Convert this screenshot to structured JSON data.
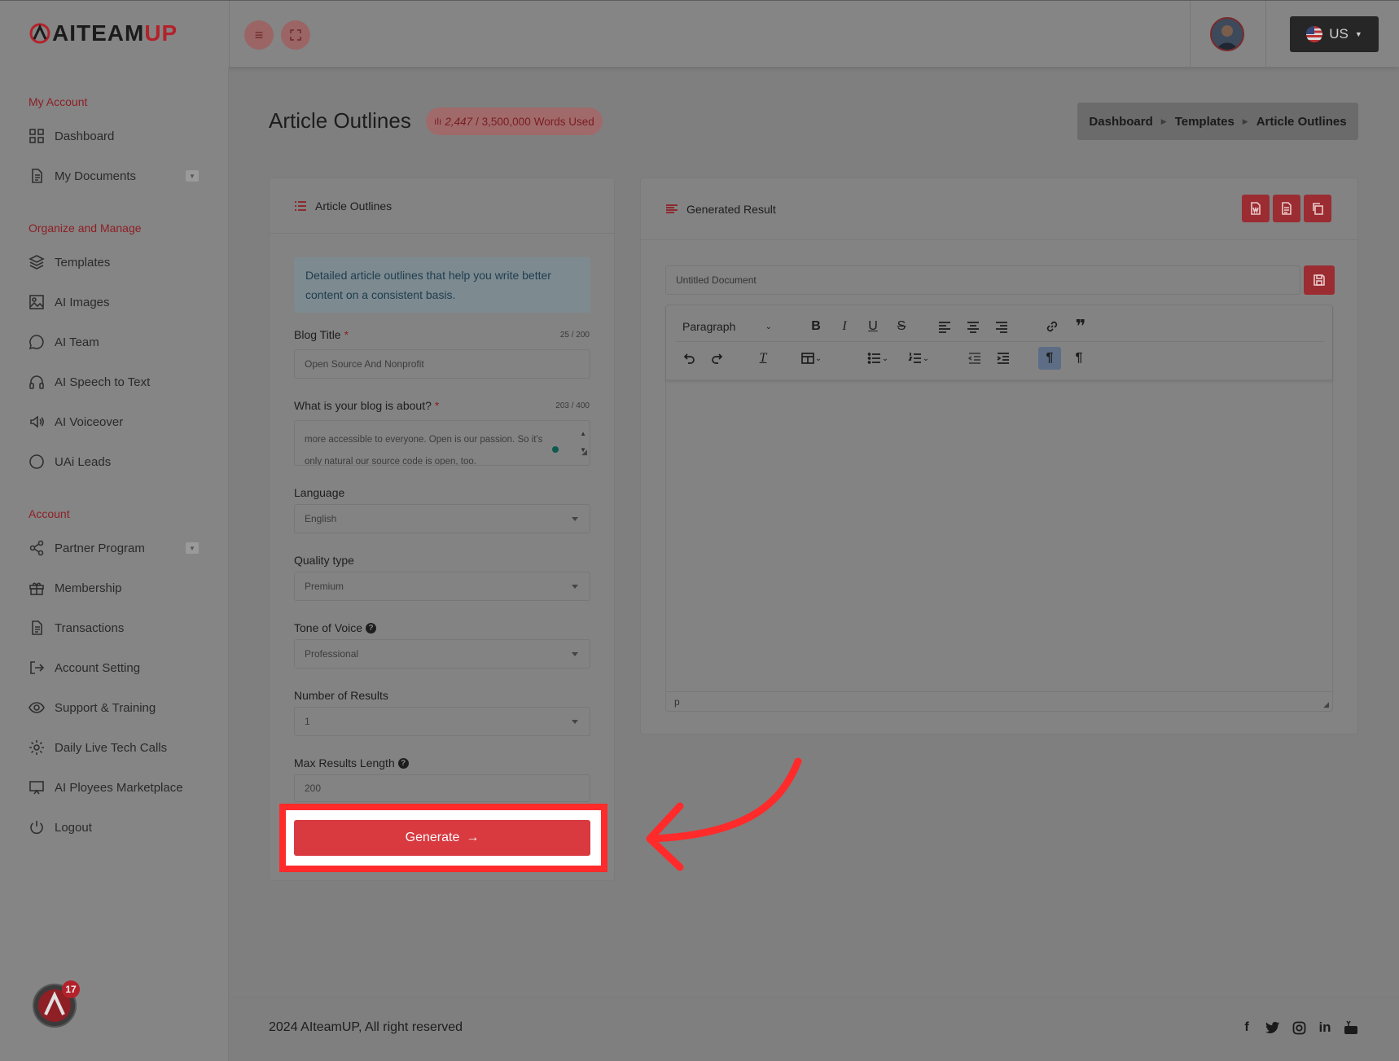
{
  "brand": {
    "name_a": "AITEAM",
    "name_b": "UP"
  },
  "header": {
    "lang": "US"
  },
  "sidebar": {
    "sections": [
      {
        "title": "My Account"
      },
      {
        "title": "Organize and Manage"
      },
      {
        "title": "Account"
      }
    ],
    "items": [
      {
        "label": "Dashboard"
      },
      {
        "label": "My Documents"
      },
      {
        "label": "Templates"
      },
      {
        "label": "AI Images"
      },
      {
        "label": "AI Team"
      },
      {
        "label": "AI Speech to Text"
      },
      {
        "label": "AI Voiceover"
      },
      {
        "label": "UAi Leads"
      },
      {
        "label": "Partner Program"
      },
      {
        "label": "Membership"
      },
      {
        "label": "Transactions"
      },
      {
        "label": "Account Setting"
      },
      {
        "label": "Support & Training"
      },
      {
        "label": "Daily Live Tech Calls"
      },
      {
        "label": "AI Ployees Marketplace"
      },
      {
        "label": "Logout"
      }
    ],
    "notification_count": "17"
  },
  "page": {
    "title": "Article Outlines",
    "words_used": "2,447",
    "words_total": "/ 3,500,000",
    "words_suffix": "Words Used"
  },
  "breadcrumb": {
    "items": [
      "Dashboard",
      "Templates",
      "Article Outlines"
    ]
  },
  "form": {
    "card_title": "Article Outlines",
    "info": "Detailed article outlines that help you write better content on a consistent basis.",
    "blog_title_label": "Blog Title",
    "blog_title_count": "25 / 200",
    "blog_title_value": "Open Source And Nonprofit",
    "about_label": "What is your blog is about?",
    "about_count": "203 / 400",
    "about_value_1": "more accessible to everyone. Open is our passion. So it's",
    "about_value_2": "only natural our source code is open, too.",
    "required_mark": "*",
    "language_label": "Language",
    "language_value": "English",
    "quality_label": "Quality type",
    "quality_value": "Premium",
    "tone_label": "Tone of Voice",
    "tone_value": "Professional",
    "results_label": "Number of Results",
    "results_value": "1",
    "max_length_label": "Max Results Length",
    "max_length_value": "200",
    "generate_label": "Generate"
  },
  "result": {
    "card_title": "Generated Result",
    "doc_name_placeholder": "Untitled Document",
    "paragraph_label": "Paragraph",
    "status_path": "p"
  },
  "footer": {
    "copyright": "2024 AIteamUP, All right reserved"
  }
}
